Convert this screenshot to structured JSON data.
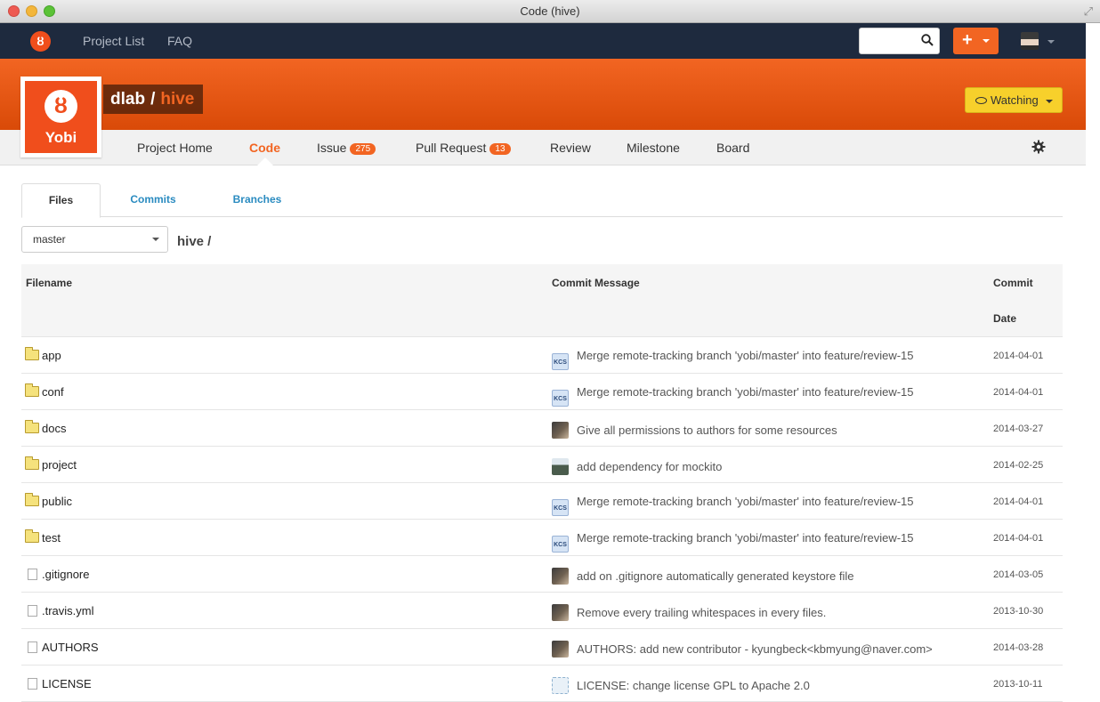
{
  "window": {
    "title": "Code (hive)"
  },
  "navbar": {
    "links": [
      "Project List",
      "FAQ"
    ],
    "search_value": "",
    "plus_label": "+"
  },
  "project": {
    "logo_text": "Yobi",
    "logo_symbol": "ȣ",
    "owner": "dlab",
    "separator": "/",
    "repo": "hive",
    "watch_label": "Watching"
  },
  "subnav": {
    "items": [
      {
        "label": "Project Home"
      },
      {
        "label": "Code"
      },
      {
        "label": "Issue",
        "badge": "275"
      },
      {
        "label": "Pull Request",
        "badge": "13"
      },
      {
        "label": "Review"
      },
      {
        "label": "Milestone"
      },
      {
        "label": "Board"
      }
    ],
    "active": "Code"
  },
  "tabs": [
    "Files",
    "Commits",
    "Branches"
  ],
  "branch": {
    "selected": "master"
  },
  "breadcrumb": "hive /",
  "table": {
    "headers": {
      "filename": "Filename",
      "message": "Commit Message",
      "date_line1": "Commit",
      "date_line2": "Date"
    },
    "rows": [
      {
        "type": "folder",
        "name": "app",
        "avatar": "kcs",
        "avatar_text": "KCS",
        "message": "Merge remote-tracking branch 'yobi/master' into feature/review-15",
        "date": "2014-04-01"
      },
      {
        "type": "folder",
        "name": "conf",
        "avatar": "kcs",
        "avatar_text": "KCS",
        "message": "Merge remote-tracking branch 'yobi/master' into feature/review-15",
        "date": "2014-04-01"
      },
      {
        "type": "folder",
        "name": "docs",
        "avatar": "photo",
        "avatar_text": "",
        "message": "Give all permissions to authors for some resources",
        "date": "2014-03-27"
      },
      {
        "type": "folder",
        "name": "project",
        "avatar": "green",
        "avatar_text": "",
        "message": "add dependency for mockito",
        "date": "2014-02-25"
      },
      {
        "type": "folder",
        "name": "public",
        "avatar": "kcs",
        "avatar_text": "KCS",
        "message": "Merge remote-tracking branch 'yobi/master' into feature/review-15",
        "date": "2014-04-01"
      },
      {
        "type": "folder",
        "name": "test",
        "avatar": "kcs",
        "avatar_text": "KCS",
        "message": "Merge remote-tracking branch 'yobi/master' into feature/review-15",
        "date": "2014-04-01"
      },
      {
        "type": "file",
        "name": ".gitignore",
        "avatar": "photo",
        "avatar_text": "",
        "message": "add on .gitignore automatically generated keystore file",
        "date": "2014-03-05"
      },
      {
        "type": "file",
        "name": ".travis.yml",
        "avatar": "photo",
        "avatar_text": "",
        "message": "Remove every trailing whitespaces in every files.",
        "date": "2013-10-30"
      },
      {
        "type": "file",
        "name": "AUTHORS",
        "avatar": "photo",
        "avatar_text": "",
        "message": "AUTHORS: add new contributor - kyungbeck<kbmyung@naver.com>",
        "date": "2014-03-28"
      },
      {
        "type": "file",
        "name": "LICENSE",
        "avatar": "pattern",
        "avatar_text": "",
        "message": "LICENSE: change license GPL to Apache 2.0",
        "date": "2013-10-11"
      }
    ]
  }
}
